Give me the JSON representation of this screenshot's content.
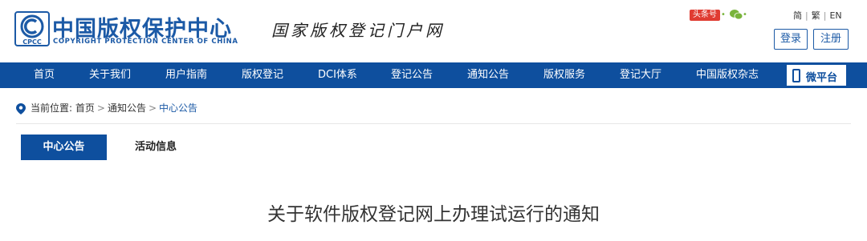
{
  "header": {
    "logo_badge": "CPCC",
    "logo_cn": "中国版权保护中心",
    "logo_en": "COPYRIGHT PROTECTION CENTER OF CHINA",
    "slogan": "国家版权登记门户网",
    "toutiao": "头条号",
    "lang": {
      "simplified": "简",
      "traditional": "繁",
      "english": "EN"
    },
    "login": "登录",
    "register": "注册"
  },
  "nav": {
    "items": [
      {
        "label": "首页"
      },
      {
        "label": "关于我们"
      },
      {
        "label": "用户指南"
      },
      {
        "label": "版权登记"
      },
      {
        "label": "DCI体系"
      },
      {
        "label": "登记公告"
      },
      {
        "label": "通知公告"
      },
      {
        "label": "版权服务"
      },
      {
        "label": "登记大厅"
      },
      {
        "label": "中国版权杂志"
      }
    ],
    "weiplatform": "微平台"
  },
  "breadcrumb": {
    "prefix": "当前位置:",
    "items": [
      "首页",
      "通知公告",
      "中心公告"
    ],
    "separator": ">"
  },
  "tabs": [
    {
      "label": "中心公告",
      "active": true
    },
    {
      "label": "活动信息",
      "active": false
    }
  ],
  "article": {
    "title": "关于软件版权登记网上办理试运行的通知"
  },
  "colors": {
    "brand_blue": "#0e4f9e",
    "logo_blue": "#1c5aa6",
    "toutiao_red": "#e03c32",
    "wechat_green": "#7ab43c"
  },
  "icons": [
    "cpcc-logo-icon",
    "toutiao-icon",
    "wechat-icon",
    "phone-icon",
    "location-pin-icon"
  ]
}
